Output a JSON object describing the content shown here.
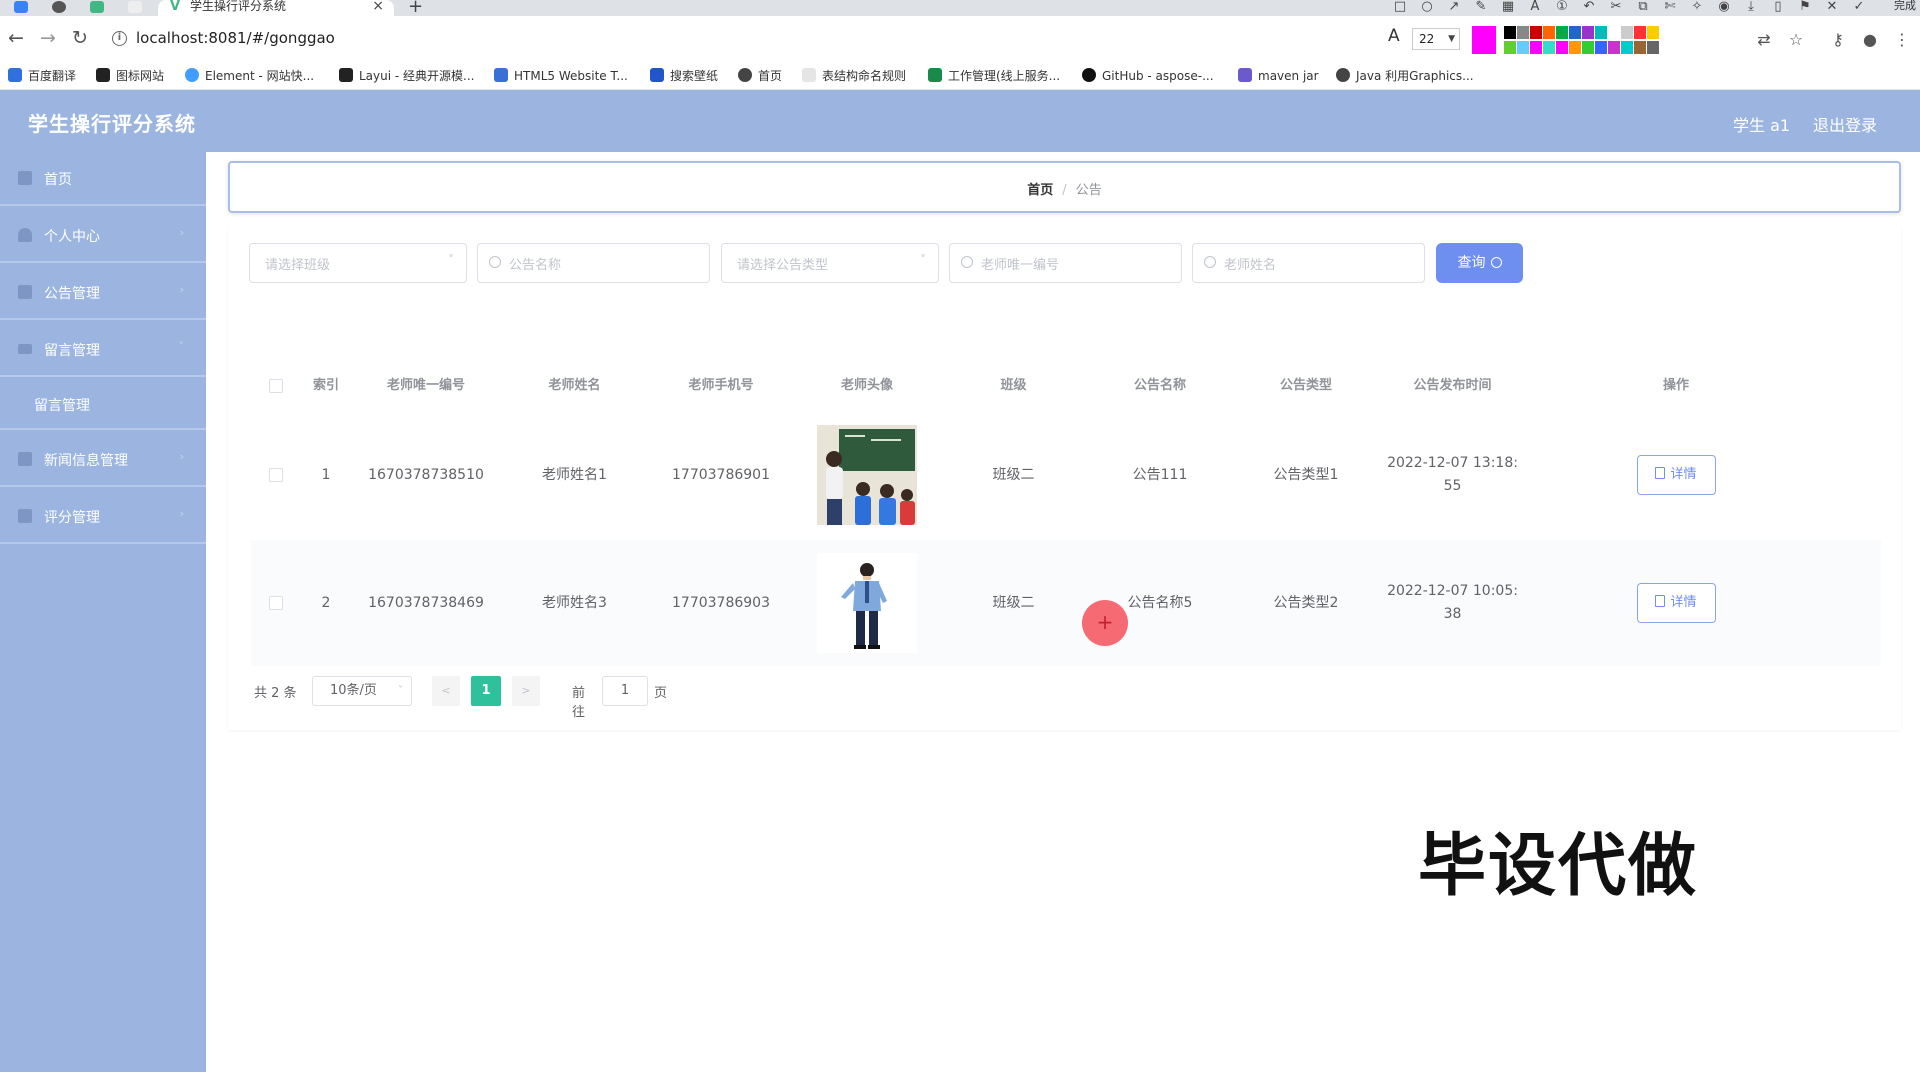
{
  "browser": {
    "tab_title": "学生操行评分系统",
    "url": "localhost:8081/#/gonggao",
    "font_size": "22",
    "tool_label": "完成",
    "palette_colors": [
      "#000000",
      "#888888",
      "#cc0000",
      "#ff6600",
      "#00aa44",
      "#2266cc",
      "#9933cc",
      "#00bbbb",
      "#ffffff",
      "#cccccc",
      "#ff3333",
      "#ffcc00",
      "#66cc33",
      "#66ccff",
      "#ff00ff",
      "#33ddcc",
      "#ff00ff",
      "#ff9900",
      "#33cc33",
      "#3366ff",
      "#cc33cc",
      "#00cccc",
      "#996633",
      "#666666"
    ],
    "bookmarks": [
      "百度翻译",
      "图标网站",
      "Element - 网站快...",
      "Layui - 经典开源模...",
      "HTML5 Website T...",
      "搜索壁纸",
      "首页",
      "表结构命名规则",
      "工作管理(线上服务...",
      "GitHub - aspose-...",
      "maven jar",
      "Java 利用Graphics..."
    ]
  },
  "app": {
    "title": "学生操行评分系统",
    "user": "学生 a1",
    "logout": "退出登录"
  },
  "sidebar": {
    "items": [
      {
        "label": "首页",
        "icon": "home-icon"
      },
      {
        "label": "个人中心",
        "icon": "user-icon"
      },
      {
        "label": "公告管理",
        "icon": "notice-icon"
      },
      {
        "label": "留言管理",
        "icon": "list-icon"
      },
      {
        "label": "留言管理",
        "icon": ""
      },
      {
        "label": "新闻信息管理",
        "icon": "news-icon"
      },
      {
        "label": "评分管理",
        "icon": "score-icon"
      }
    ]
  },
  "breadcrumb": {
    "home": "首页",
    "separator": "/",
    "current": "公告"
  },
  "filters": {
    "class_select": "请选择班级",
    "notice_name": "公告名称",
    "notice_type_select": "请选择公告类型",
    "teacher_id": "老师唯一编号",
    "teacher_name": "老师姓名",
    "query_button": "查询"
  },
  "table": {
    "columns": [
      "索引",
      "老师唯一编号",
      "老师姓名",
      "老师手机号",
      "老师头像",
      "班级",
      "公告名称",
      "公告类型",
      "公告发布时间",
      "操作"
    ],
    "rows": [
      {
        "index": "1",
        "teacher_id": "1670378738510",
        "teacher_name": "老师姓名1",
        "phone": "17703786901",
        "class": "班级二",
        "notice_name": "公告111",
        "notice_type": "公告类型1",
        "time_1": "2022-12-07 13:18:",
        "time_2": "55",
        "action": "详情"
      },
      {
        "index": "2",
        "teacher_id": "1670378738469",
        "teacher_name": "老师姓名3",
        "phone": "17703786903",
        "class": "班级二",
        "notice_name": "公告名称5",
        "notice_type": "公告类型2",
        "time_1": "2022-12-07 10:05:",
        "time_2": "38",
        "action": "详情"
      }
    ]
  },
  "pagination": {
    "total": "共 2 条",
    "page_size": "10条/页",
    "prev": "<",
    "current": "1",
    "next": ">",
    "goto": "前往",
    "goto_value": "1",
    "unit": "页"
  },
  "watermark": "毕设代做",
  "colors": {
    "header_bg": "#9bb5e0",
    "primary": "#6e8ef0",
    "page_active": "#2ec19b"
  }
}
